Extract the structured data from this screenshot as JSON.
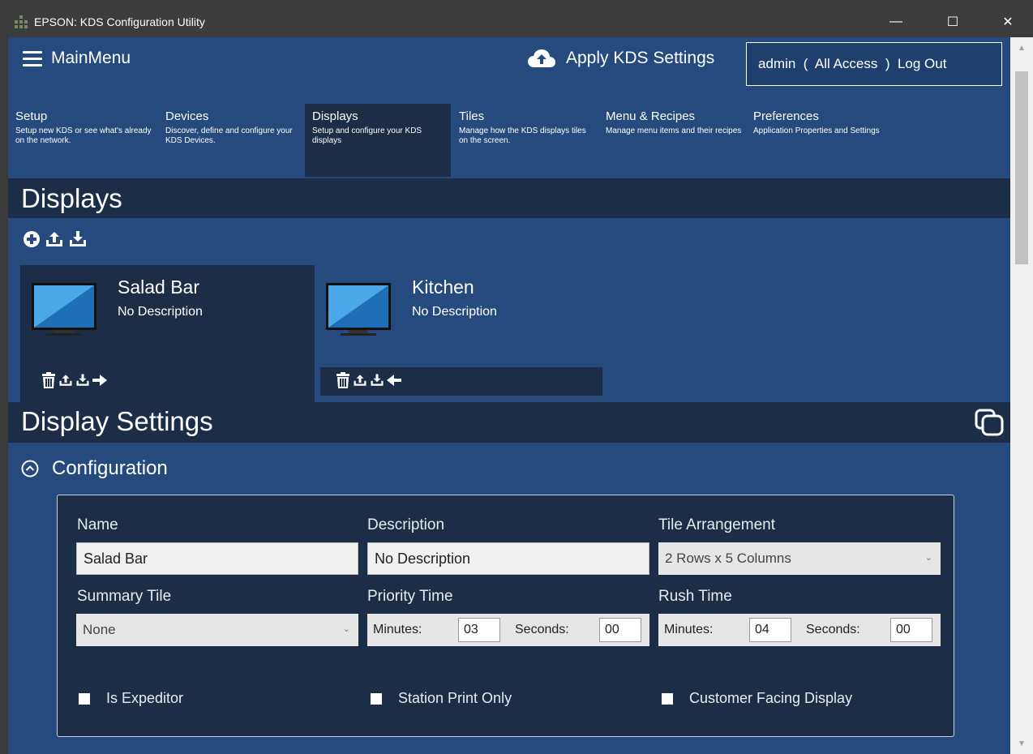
{
  "window": {
    "title": "EPSON: KDS Configuration Utility",
    "minimize": "—",
    "maximize": "☐",
    "close": "✕"
  },
  "header": {
    "menu_label": "MainMenu",
    "apply_label": "Apply KDS Settings",
    "account_text": "admin  (  All Access  )  Log Out"
  },
  "nav": [
    {
      "title": "Setup",
      "desc": "Setup new KDS or see what's already on the network."
    },
    {
      "title": "Devices",
      "desc": "Discover, define and configure your KDS Devices."
    },
    {
      "title": "Displays",
      "desc": "Setup and configure your KDS displays"
    },
    {
      "title": "Tiles",
      "desc": "Manage how the KDS displays tiles on the screen."
    },
    {
      "title": "Menu & Recipes",
      "desc": "Manage menu items and their recipes"
    },
    {
      "title": "Preferences",
      "desc": "Application Properties and Settings"
    }
  ],
  "active_nav": "Displays",
  "displays_section": {
    "title": "Displays"
  },
  "cards": [
    {
      "name": "Salad Bar",
      "desc": "No Description",
      "arrow": "right"
    },
    {
      "name": "Kitchen",
      "desc": "No Description",
      "arrow": "left"
    }
  ],
  "settings_section": {
    "title": "Display Settings"
  },
  "configuration": {
    "title": "Configuration",
    "name_label": "Name",
    "name_value": "Salad Bar",
    "description_label": "Description",
    "description_value": "No Description",
    "tile_arrangement_label": "Tile Arrangement",
    "tile_arrangement_value": "2 Rows x 5 Columns",
    "summary_tile_label": "Summary Tile",
    "summary_tile_value": "None",
    "priority_time_label": "Priority Time",
    "rush_time_label": "Rush Time",
    "minutes_label": "Minutes:",
    "seconds_label": "Seconds:",
    "priority_minutes": "03",
    "priority_seconds": "00",
    "rush_minutes": "04",
    "rush_seconds": "00",
    "is_expeditor_label": "Is Expeditor",
    "station_print_only_label": "Station Print Only",
    "customer_facing_label": "Customer Facing Display"
  },
  "colors": {
    "background": "#264a7e",
    "dark_panel": "#1b2d47",
    "titlebar": "#3c3c3c"
  }
}
